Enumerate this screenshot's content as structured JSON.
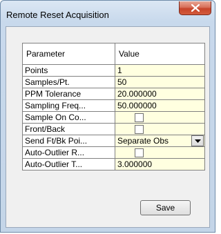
{
  "window": {
    "title": "Remote Reset Acquisition"
  },
  "table": {
    "headers": [
      "Parameter",
      "Value"
    ],
    "rows": [
      {
        "param": "Points",
        "value": "1"
      },
      {
        "param": "Samples/Pt.",
        "value": "50"
      },
      {
        "param": "PPM Tolerance",
        "value": "20.000000"
      },
      {
        "param": "Sampling Freq...",
        "value": "50.000000"
      },
      {
        "param": "Sample On Co...",
        "value": ""
      },
      {
        "param": "Front/Back",
        "value": ""
      },
      {
        "param": "Send Ft/Bk Poi...",
        "value": "Separate Obs"
      },
      {
        "param": "Auto-Outlier R...",
        "value": ""
      },
      {
        "param": "Auto-Outlier T...",
        "value": "3.000000"
      }
    ]
  },
  "buttons": {
    "save_label": "Save"
  },
  "icons": {
    "close": "close-x-icon",
    "dropdown": "chevron-down-icon"
  }
}
